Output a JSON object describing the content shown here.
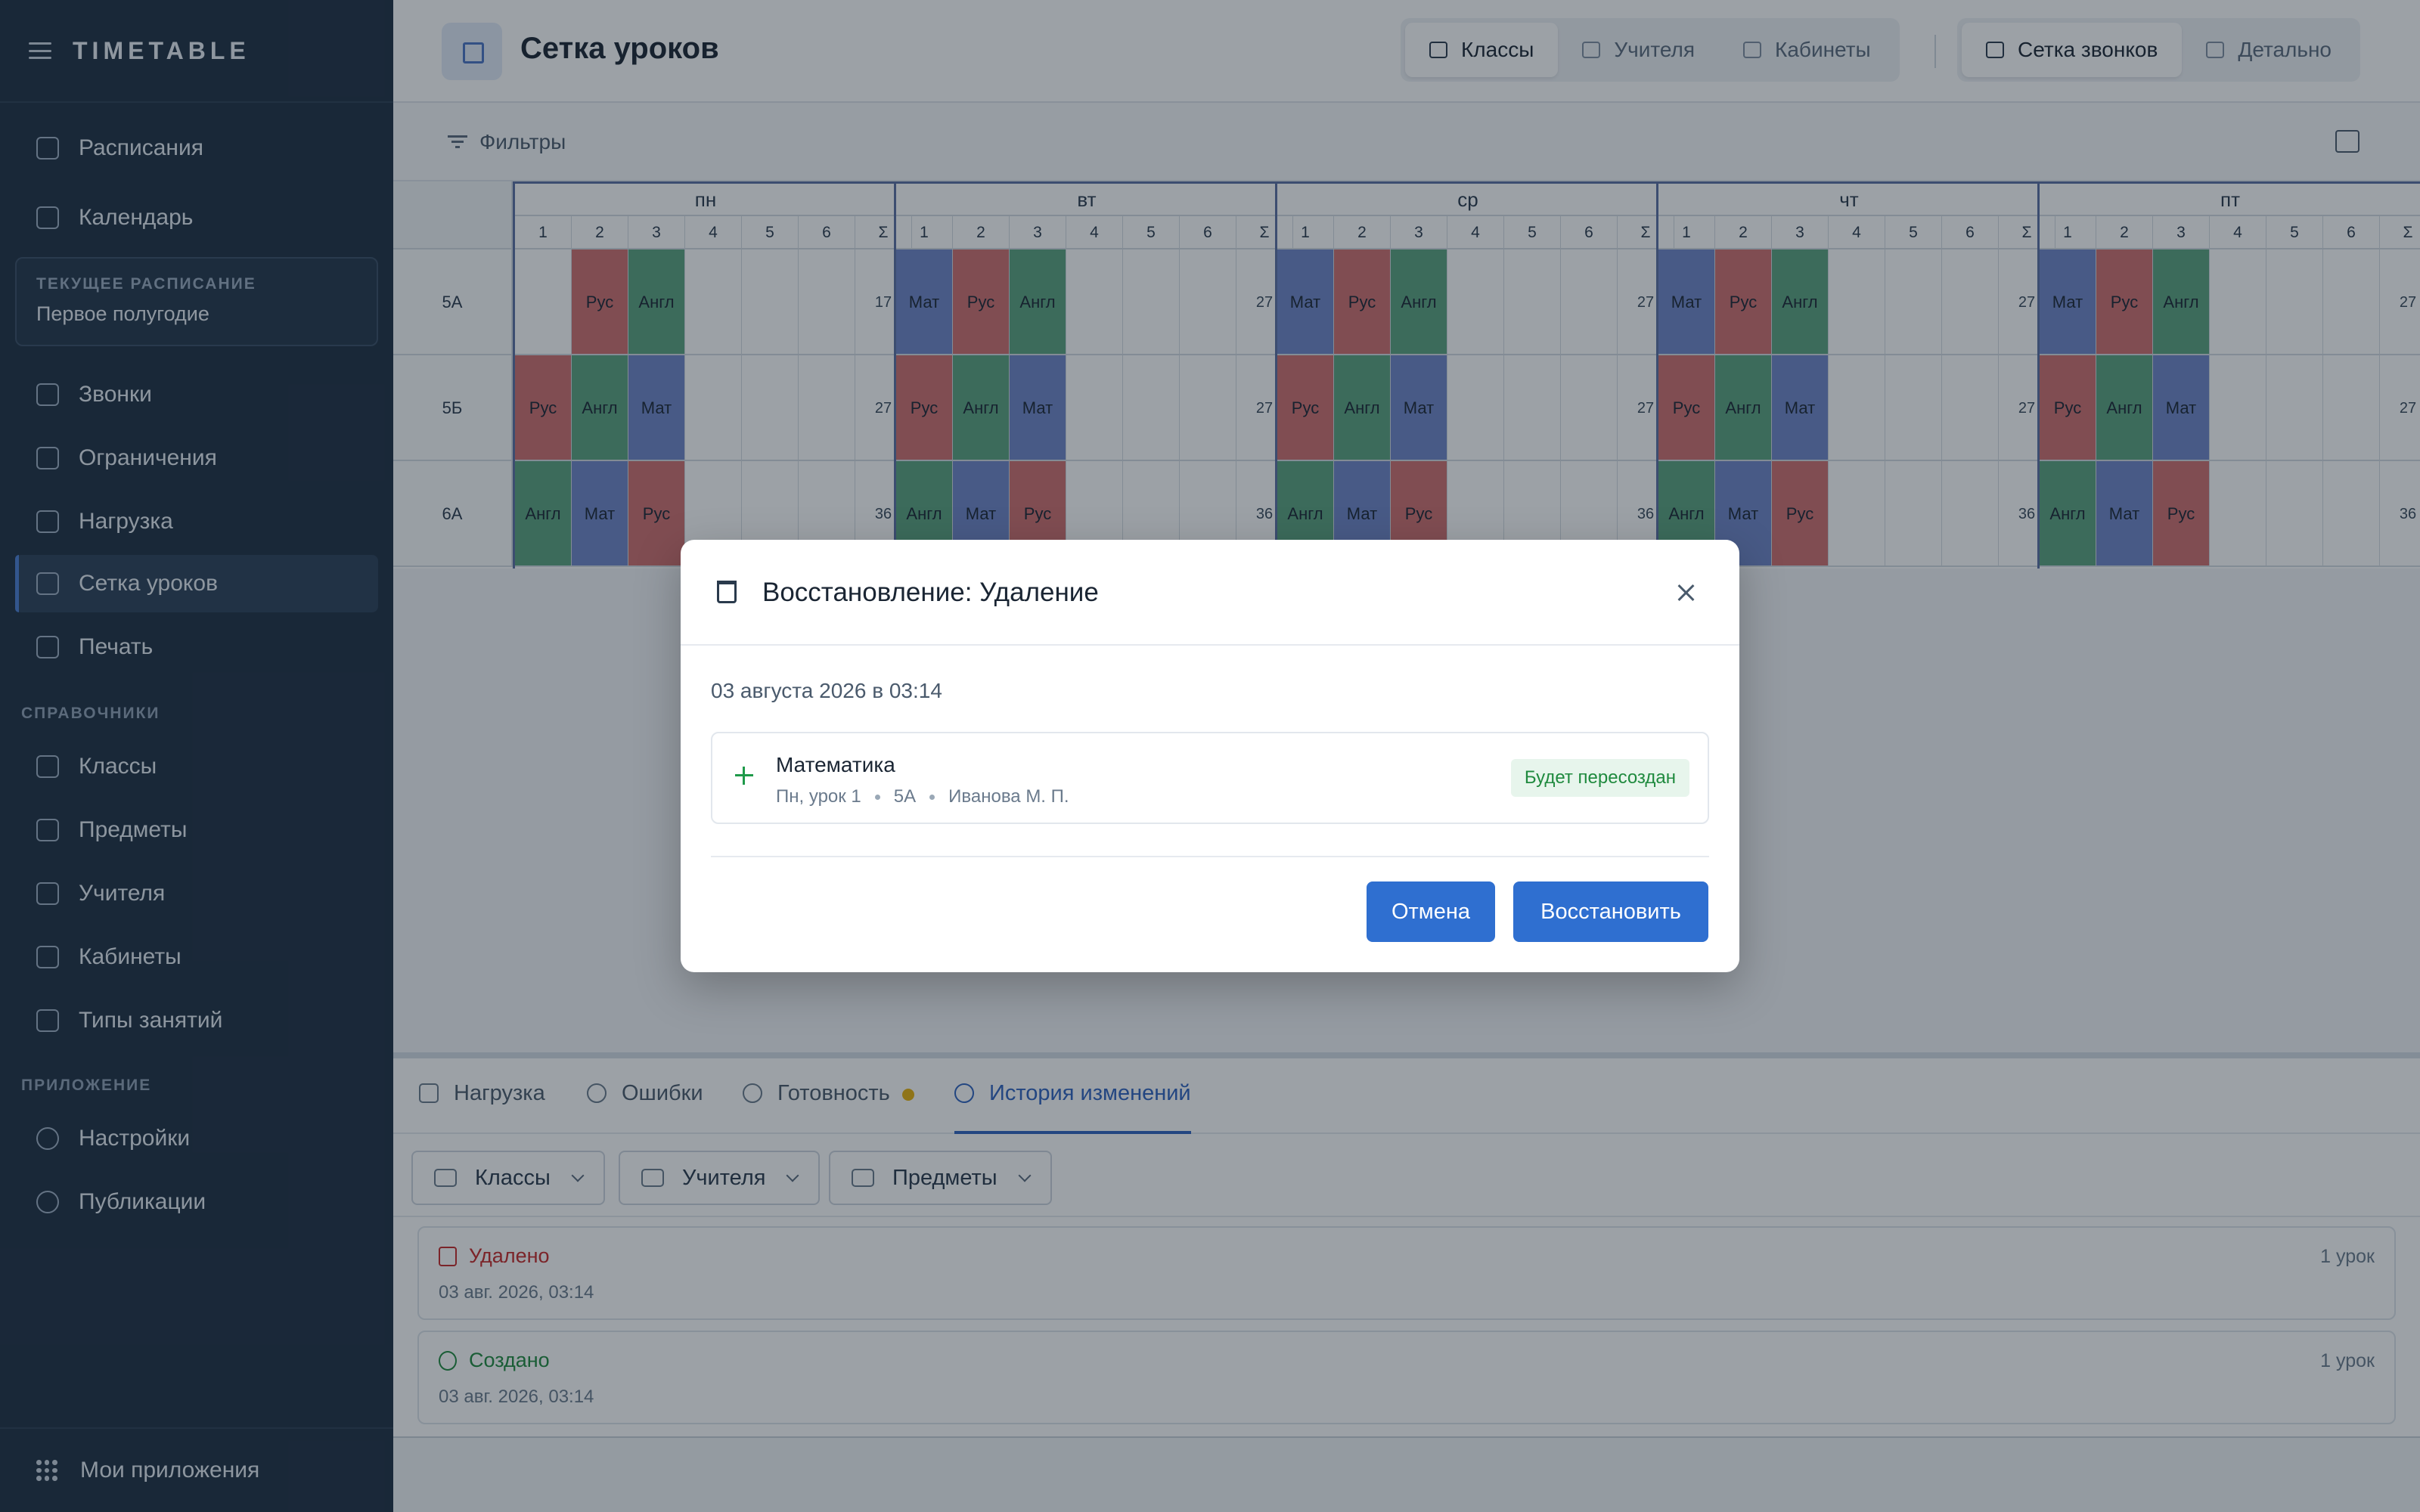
{
  "app": {
    "title": "TIMETABLE"
  },
  "sidebar": {
    "items_top": [
      {
        "label": "Расписания",
        "name": "sidebar-item-schedules"
      },
      {
        "label": "Календарь",
        "name": "sidebar-item-calendar"
      }
    ],
    "current_schedule": {
      "caption": "ТЕКУЩЕЕ РАСПИСАНИЕ",
      "value": "Первое полугодие"
    },
    "items_main": [
      {
        "label": "Звонки",
        "name": "sidebar-item-bells"
      },
      {
        "label": "Ограничения",
        "name": "sidebar-item-constraints"
      },
      {
        "label": "Нагрузка",
        "name": "sidebar-item-load"
      },
      {
        "label": "Сетка уроков",
        "name": "sidebar-item-lesson-grid",
        "active": true
      },
      {
        "label": "Печать",
        "name": "sidebar-item-print"
      }
    ],
    "section_refs": "СПРАВОЧНИКИ",
    "items_refs": [
      {
        "label": "Классы",
        "name": "sidebar-item-classes"
      },
      {
        "label": "Предметы",
        "name": "sidebar-item-subjects"
      },
      {
        "label": "Учителя",
        "name": "sidebar-item-teachers"
      },
      {
        "label": "Кабинеты",
        "name": "sidebar-item-rooms"
      },
      {
        "label": "Типы занятий",
        "name": "sidebar-item-lesson-types"
      }
    ],
    "section_app": "ПРИЛОЖЕНИЕ",
    "items_app": [
      {
        "label": "Настройки",
        "name": "sidebar-item-settings"
      },
      {
        "label": "Публикации",
        "name": "sidebar-item-publications"
      }
    ],
    "footer": "Мои приложения"
  },
  "header": {
    "title": "Сетка уроков",
    "view_tabs": [
      "Классы",
      "Учителя",
      "Кабинеты"
    ],
    "mode_tabs": [
      "Сетка звонков",
      "Детально"
    ]
  },
  "filters": {
    "label": "Фильтры"
  },
  "grid": {
    "days": [
      "пн",
      "вт",
      "ср",
      "чт",
      "пт"
    ],
    "slots": [
      "1",
      "2",
      "3",
      "4",
      "5",
      "6",
      "Σ"
    ],
    "rows": [
      {
        "class": "5А",
        "days": [
          {
            "lessons": [
              "",
              "Рус",
              "Англ",
              "",
              "",
              ""
            ],
            "sum": "17"
          },
          {
            "lessons": [
              "Мат",
              "Рус",
              "Англ",
              "",
              "",
              ""
            ],
            "sum": "27"
          },
          {
            "lessons": [
              "Мат",
              "Рус",
              "Англ",
              "",
              "",
              ""
            ],
            "sum": "27"
          },
          {
            "lessons": [
              "Мат",
              "Рус",
              "Англ",
              "",
              "",
              ""
            ],
            "sum": "27"
          },
          {
            "lessons": [
              "Мат",
              "Рус",
              "Англ",
              "",
              "",
              ""
            ],
            "sum": "27"
          }
        ]
      },
      {
        "class": "5Б",
        "days": [
          {
            "lessons": [
              "Рус",
              "Англ",
              "Мат",
              "",
              "",
              ""
            ],
            "sum": "27"
          },
          {
            "lessons": [
              "Рус",
              "Англ",
              "Мат",
              "",
              "",
              ""
            ],
            "sum": "27"
          },
          {
            "lessons": [
              "Рус",
              "Англ",
              "Мат",
              "",
              "",
              ""
            ],
            "sum": "27"
          },
          {
            "lessons": [
              "Рус",
              "Англ",
              "Мат",
              "",
              "",
              ""
            ],
            "sum": "27"
          },
          {
            "lessons": [
              "Рус",
              "Англ",
              "Мат",
              "",
              "",
              ""
            ],
            "sum": "27"
          }
        ]
      },
      {
        "class": "6А",
        "days": [
          {
            "lessons": [
              "Англ",
              "Мат",
              "Рус",
              "",
              "",
              ""
            ],
            "sum": "36"
          },
          {
            "lessons": [
              "Англ",
              "Мат",
              "Рус",
              "",
              "",
              ""
            ],
            "sum": "36"
          },
          {
            "lessons": [
              "Англ",
              "Мат",
              "Рус",
              "",
              "",
              ""
            ],
            "sum": "36"
          },
          {
            "lessons": [
              "Англ",
              "Мат",
              "Рус",
              "",
              "",
              ""
            ],
            "sum": "36"
          },
          {
            "lessons": [
              "Англ",
              "Мат",
              "Рус",
              "",
              "",
              ""
            ],
            "sum": "36"
          }
        ]
      }
    ],
    "colors": {
      "Мат": "#6f86c9",
      "Рус": "#cf6e6e",
      "Англ": "#5aa27f"
    }
  },
  "bottom": {
    "tabs": [
      "Нагрузка",
      "Ошибки",
      "Готовность",
      "История изменений"
    ],
    "filter_buttons": [
      "Классы",
      "Учителя",
      "Предметы"
    ],
    "history": [
      {
        "title": "Удалено",
        "date": "03 авг. 2026, 03:14",
        "count": "1 урок",
        "kind": "deleted"
      },
      {
        "title": "Создано",
        "date": "03 авг. 2026, 03:14",
        "count": "1 урок",
        "kind": "created"
      }
    ]
  },
  "modal": {
    "title": "Восстановление: Удаление",
    "date": "03 августа 2026 в 03:14",
    "item": {
      "subject": "Математика",
      "slot": "Пн, урок 1",
      "class": "5А",
      "teacher": "Иванова М. П.",
      "badge": "Будет пересоздан"
    },
    "cancel_label": "Отмена",
    "confirm_label": "Восстановить"
  },
  "colors": {
    "accent": "#2f6fd0",
    "sidebar_bg": "#1e2f42",
    "deleted": "#c62828",
    "created": "#1f8a3e"
  }
}
